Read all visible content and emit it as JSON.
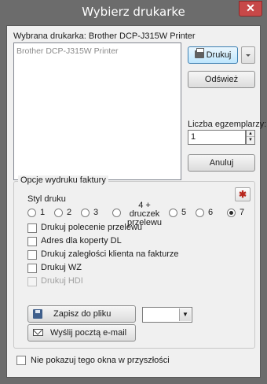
{
  "window": {
    "title": "Wybierz drukarke",
    "close_label": "✕"
  },
  "printer": {
    "selected_label": "Wybrana drukarka: Brother DCP-J315W Printer",
    "list": [
      "Brother DCP-J315W Printer"
    ]
  },
  "buttons": {
    "print": "Drukuj",
    "refresh": "Odśwież",
    "cancel": "Anuluj",
    "save_to_file": "Zapisz do pliku",
    "send_email": "Wyślij pocztą e-mail"
  },
  "copies": {
    "label": "Liczba egzemplarzy:",
    "value": "1"
  },
  "invoice_options": {
    "title": "Opcje wydruku faktury",
    "style_label": "Styl druku",
    "styles": [
      "1",
      "2",
      "3",
      "4 + druczek przelewu",
      "5",
      "6",
      "7"
    ],
    "selected_style": "7",
    "checkboxes": [
      {
        "label": "Drukuj polecenie przelewu",
        "checked": false,
        "enabled": true
      },
      {
        "label": "Adres dla koperty DL",
        "checked": false,
        "enabled": true
      },
      {
        "label": "Drukuj zaległości klienta na fakturze",
        "checked": false,
        "enabled": true
      },
      {
        "label": "Drukuj WZ",
        "checked": false,
        "enabled": true
      },
      {
        "label": "Drukuj HDI",
        "checked": false,
        "enabled": false
      }
    ],
    "file_format_value": ""
  },
  "footer": {
    "dont_show_label": "Nie pokazuj tego okna w przyszłości",
    "dont_show_checked": false
  },
  "icons": {
    "print": "printer-icon",
    "save": "floppy-disk-icon",
    "email": "envelope-icon",
    "settings": "settings-icon",
    "close": "close-icon"
  },
  "colors": {
    "titlebar": "#6c6c6c",
    "client_bg": "#f0f0f0",
    "close_button": "#c74848",
    "primary_button_border": "#3c7fb1"
  }
}
